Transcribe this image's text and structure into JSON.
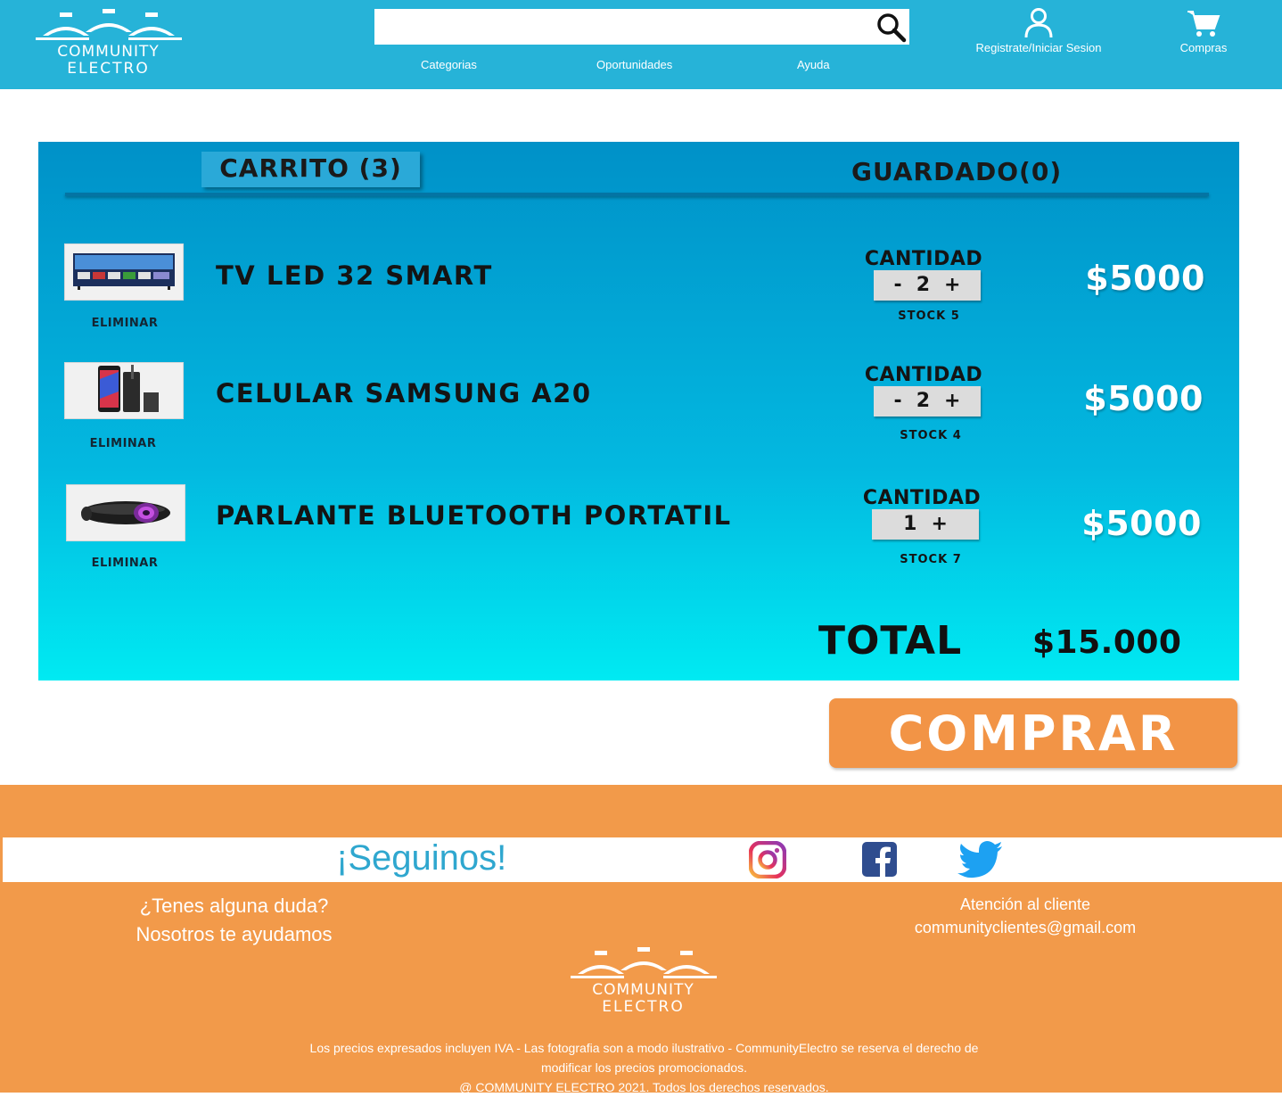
{
  "brand": {
    "line1": "COMMUNITY",
    "line2": "ELECTRO"
  },
  "search": {
    "value": "",
    "placeholder": ""
  },
  "nav": {
    "categorias": "Categorias",
    "oportunidades": "Oportunidades",
    "ayuda": "Ayuda"
  },
  "account": {
    "label": "Registrate/Iniciar Sesion"
  },
  "cart_link": {
    "label": "Compras"
  },
  "tabs": {
    "cart": "CARRITO (3)",
    "saved": "GUARDADO(0)"
  },
  "items": [
    {
      "name": "TV LED 32 SMART",
      "remove": "ELIMINAR",
      "qty_label": "CANTIDAD",
      "minus": "-",
      "qty": "2",
      "plus": "+",
      "stock": "STOCK 5",
      "price": "$5000"
    },
    {
      "name": "CELULAR SAMSUNG A20",
      "remove": "ELIMINAR",
      "qty_label": "CANTIDAD",
      "minus": "-",
      "qty": "2",
      "plus": "+",
      "stock": "STOCK 4",
      "price": "$5000"
    },
    {
      "name": "PARLANTE BLUETOOTH PORTATIL",
      "remove": "ELIMINAR",
      "qty_label": "CANTIDAD",
      "qty": "1",
      "plus": "+",
      "stock": "STOCK 7",
      "price": "$5000"
    }
  ],
  "total": {
    "label": "TOTAL",
    "value": "$15.000"
  },
  "buy": {
    "label": "COMPRAR"
  },
  "footer": {
    "follow": "¡Seguinos!",
    "help_line1": "¿Tenes alguna duda?",
    "help_line2": "Nosotros te ayudamos",
    "contact_line1": "Atención al cliente",
    "contact_email": "communityclientes@gmail.com",
    "legal_line1": "Los precios expresados incluyen IVA - Las fotografia son a modo ilustrativo - CommunityElectro se reserva el derecho de",
    "legal_line2": "modificar los precios promocionados.",
    "legal_line3": "@ COMMUNITY ELECTRO 2021. Todos los derechos reservados."
  },
  "icons": {
    "search": "search-icon",
    "user": "user-icon",
    "cart": "cart-icon",
    "instagram": "instagram-icon",
    "facebook": "facebook-icon",
    "twitter": "twitter-icon"
  },
  "colors": {
    "header": "#26b3d8",
    "panel_top": "#0091c8",
    "panel_bottom": "#00eaf2",
    "buy_button": "#f29446",
    "footer": "#f29a4a",
    "follow_text": "#2fa7cf"
  }
}
